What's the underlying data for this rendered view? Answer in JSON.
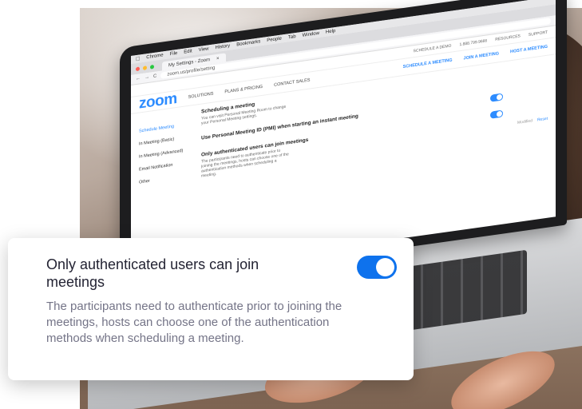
{
  "browser": {
    "menubar": [
      "Chrome",
      "File",
      "Edit",
      "View",
      "History",
      "Bookmarks",
      "People",
      "Tab",
      "Window",
      "Help"
    ],
    "tab_title": "My Settings - Zoom",
    "url": "zoom.us/profile/setting"
  },
  "zoom": {
    "top_links": [
      "SCHEDULE A DEMO",
      "1.888.799.9666",
      "RESOURCES",
      "SUPPORT"
    ],
    "logo": "zoom",
    "nav": [
      "SOLUTIONS",
      "PLANS & PRICING",
      "CONTACT SALES"
    ],
    "cta_links": [
      "SCHEDULE A MEETING",
      "JOIN A MEETING",
      "HOST A MEETING"
    ],
    "side_nav": [
      "Schedule Meeting",
      "In Meeting (Basic)",
      "In Meeting (Advanced)",
      "Email Notification",
      "Other"
    ],
    "settings": [
      {
        "title": "Scheduling a meeting",
        "desc": "You can visit Personal Meeting Room to change your Personal Meeting settings."
      },
      {
        "title": "Use Personal Meeting ID (PMI) when starting an instant meeting",
        "desc": ""
      },
      {
        "title": "Only authenticated users can join meetings",
        "desc": "The participants need to authenticate prior to joining the meetings, hosts can choose one of the authentication methods when scheduling a meeting."
      }
    ],
    "modify_links": [
      "Modified",
      "Reset"
    ]
  },
  "callout": {
    "title": "Only authenticated users can join meetings",
    "description": "The participants need to authenticate prior to joining the meetings, hosts can choose one of the authentication methods when scheduling a meeting.",
    "toggle_on": true
  },
  "colors": {
    "accent": "#0e72ed",
    "zoom_blue": "#2d8cff",
    "title_text": "#232333",
    "desc_text": "#747487"
  }
}
